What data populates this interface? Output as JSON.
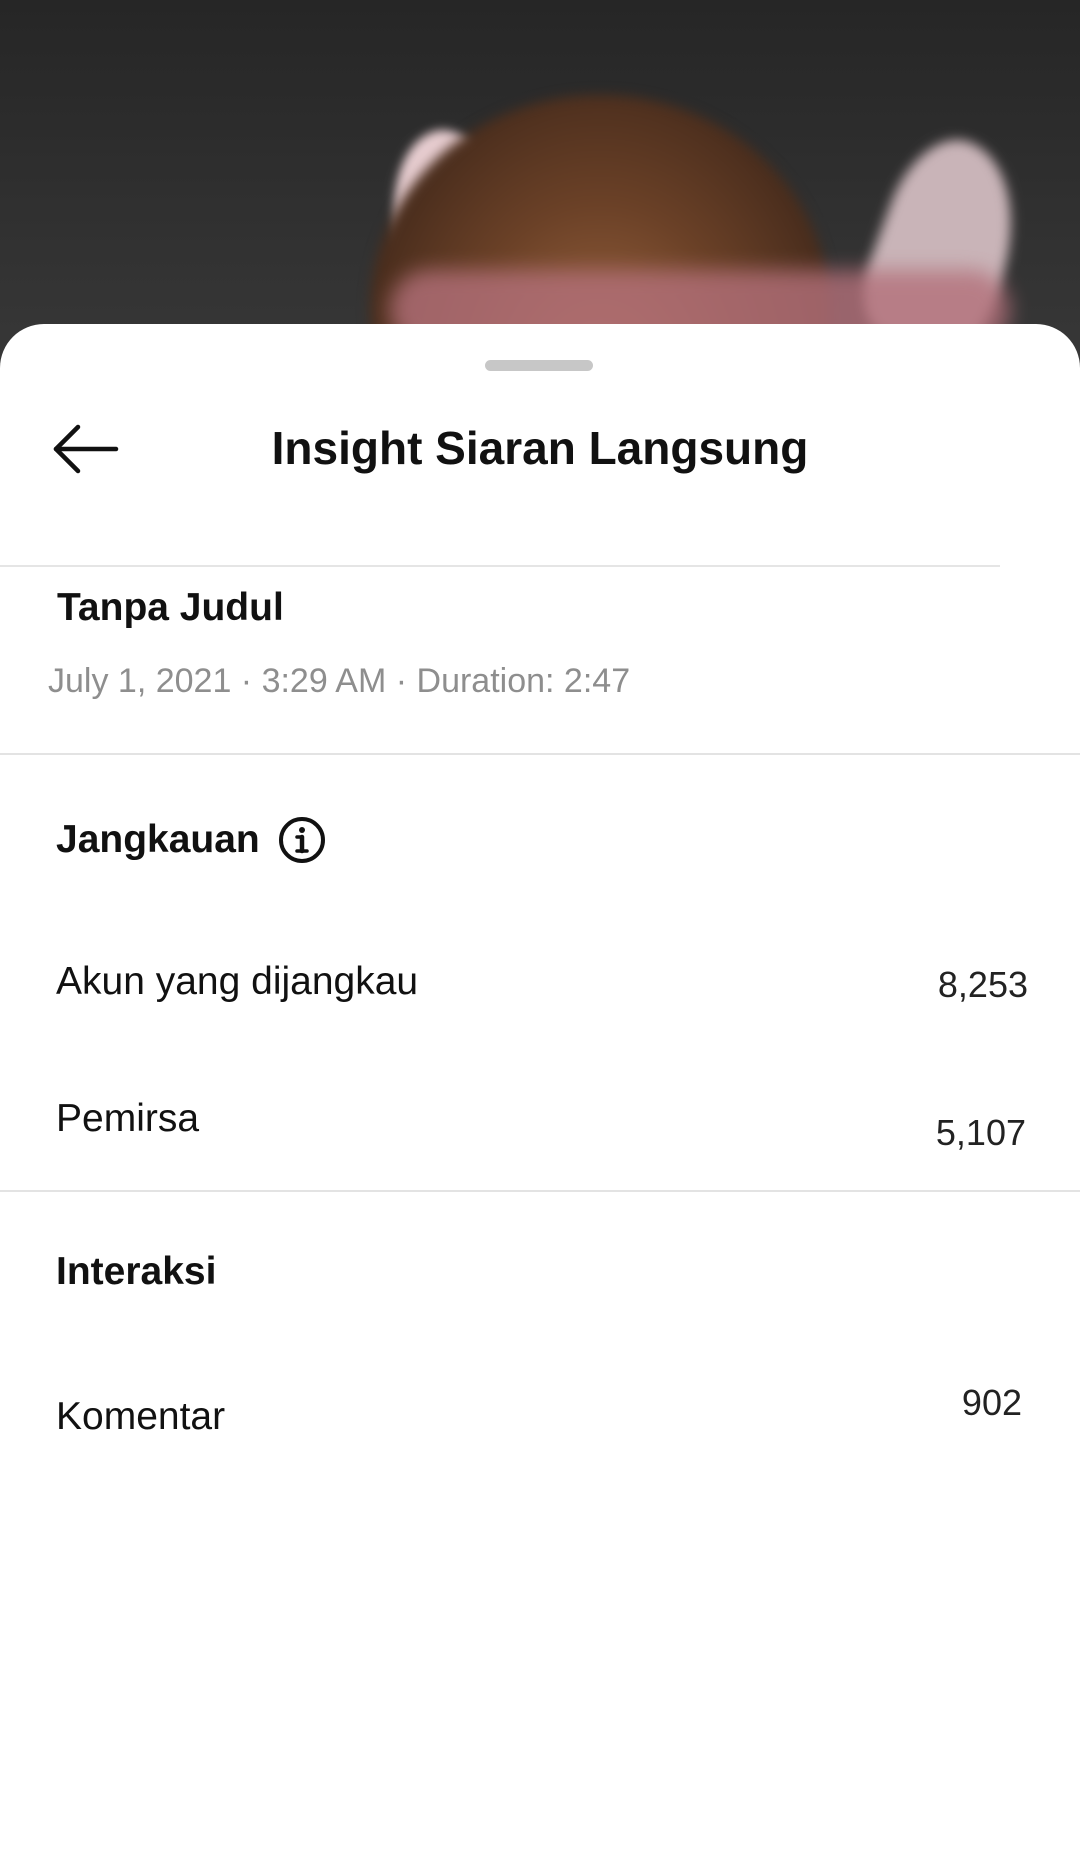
{
  "header": {
    "title": "Insight Siaran Langsung",
    "back_icon": "arrow-left-icon"
  },
  "broadcast": {
    "title": "Tanpa Judul",
    "meta": "July 1, 2021 · 3:29 AM · Duration: 2:47"
  },
  "reach": {
    "heading": "Jangkauan",
    "info_icon": "info-circle-icon",
    "rows": [
      {
        "label": "Akun yang dijangkau",
        "value": "8,253"
      },
      {
        "label": "Pemirsa",
        "value": "5,107"
      }
    ]
  },
  "interactions": {
    "heading": "Interaksi",
    "rows": [
      {
        "label": "Komentar",
        "value": "902"
      }
    ]
  }
}
